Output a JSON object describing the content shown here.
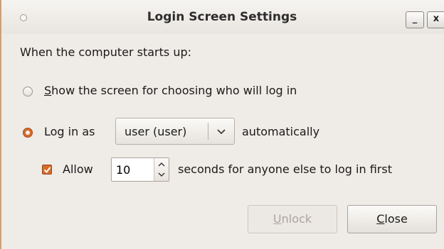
{
  "window": {
    "title": "Login Screen Settings",
    "minimize_label": "_",
    "close_label": "x"
  },
  "startup_label": "When the computer starts up:",
  "options": {
    "show_screen": {
      "mnemonic": "S",
      "rest": "how the screen for choosing who will log in",
      "selected": false
    },
    "auto_login": {
      "label": "Log in as",
      "user_value": "user (user)",
      "suffix": "automatically",
      "selected": true
    }
  },
  "allow": {
    "label": "Allow",
    "seconds_value": "10",
    "suffix": "seconds for anyone else to log in first",
    "checked": true
  },
  "buttons": {
    "unlock": {
      "mnemonic": "U",
      "rest": "nlock",
      "enabled": false
    },
    "close": {
      "mnemonic": "C",
      "rest": "lose",
      "enabled": true
    }
  },
  "colors": {
    "accent": "#d46b2c",
    "background": "#efebe7",
    "window_border": "#c9a27a"
  },
  "icons": {
    "window_menu": "window-menu-icon",
    "combo": "chevron-down-icon",
    "spin_up": "chevron-up-icon",
    "spin_down": "chevron-down-icon",
    "check": "checkmark-icon"
  }
}
